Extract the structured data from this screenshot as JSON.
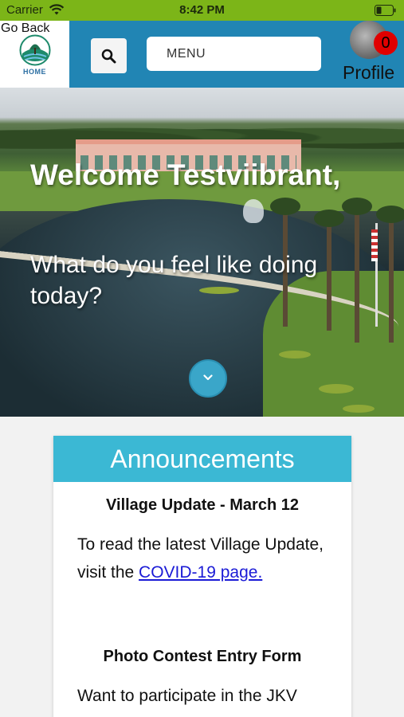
{
  "status_bar": {
    "carrier": "Carrier",
    "time": "8:42 PM"
  },
  "header": {
    "go_back": "Go Back",
    "home_label": "HOME",
    "menu_label": "MENU",
    "badge_count": "0",
    "profile_label": "Profile"
  },
  "hero": {
    "welcome": "Welcome Testviibrant,",
    "prompt": "What do you feel like doing today?"
  },
  "announcements": {
    "title": "Announcements",
    "items": [
      {
        "title": "Village Update - March 12",
        "body_prefix": "To read the latest Village Update, visit the ",
        "link_text": "COVID-19 page. "
      },
      {
        "title": "Photo Contest Entry Form",
        "body": "Want to participate in the JKV"
      }
    ]
  },
  "colors": {
    "status_bar": "#7cb518",
    "header": "#2185b4",
    "accent": "#3bb8d4",
    "badge": "#e00000",
    "link": "#1b1bd6"
  },
  "icons": [
    "wifi-icon",
    "battery-icon",
    "home-logo-icon",
    "search-icon",
    "avatar",
    "chevron-down-icon"
  ]
}
